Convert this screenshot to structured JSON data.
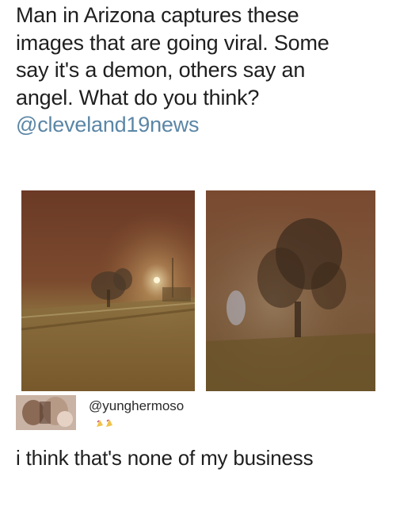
{
  "caption": {
    "lines": [
      "Man in Arizona captures these",
      "images that are going viral. Some",
      "say it's a demon, others say an",
      "angel. What do you think?"
    ],
    "handle": "@cleveland19news"
  },
  "reply": {
    "username": "@yunghermoso",
    "text": "i think that's none of my business"
  },
  "colors": {
    "handle": "#5b86a6",
    "text": "#1f1f1f",
    "background": "#ffffff"
  }
}
